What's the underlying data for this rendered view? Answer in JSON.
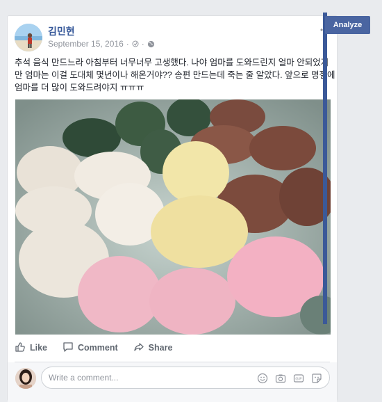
{
  "post": {
    "author": "김민현",
    "date": "September 15, 2016",
    "text": "추석 음식 만드느라 아침부터 너무너무 고생했다. 나야 엄마를 도와드린지 얼마 안되었지만 엄마는 이걸 도대체 몇년이나 해온거야?? 송편 만드는데 죽는 줄 알았다. 앞으로 명절에 엄마를 더 많이 도와드려야지 ㅠㅠㅠ"
  },
  "actions": {
    "like": "Like",
    "comment": "Comment",
    "share": "Share"
  },
  "comment_box": {
    "placeholder": "Write a comment..."
  },
  "overlay": {
    "analyze": "Analyze"
  },
  "colors": {
    "brand": "#365899",
    "analyze_bg": "#4a65a1",
    "analyze_bar": "#3b5998"
  }
}
